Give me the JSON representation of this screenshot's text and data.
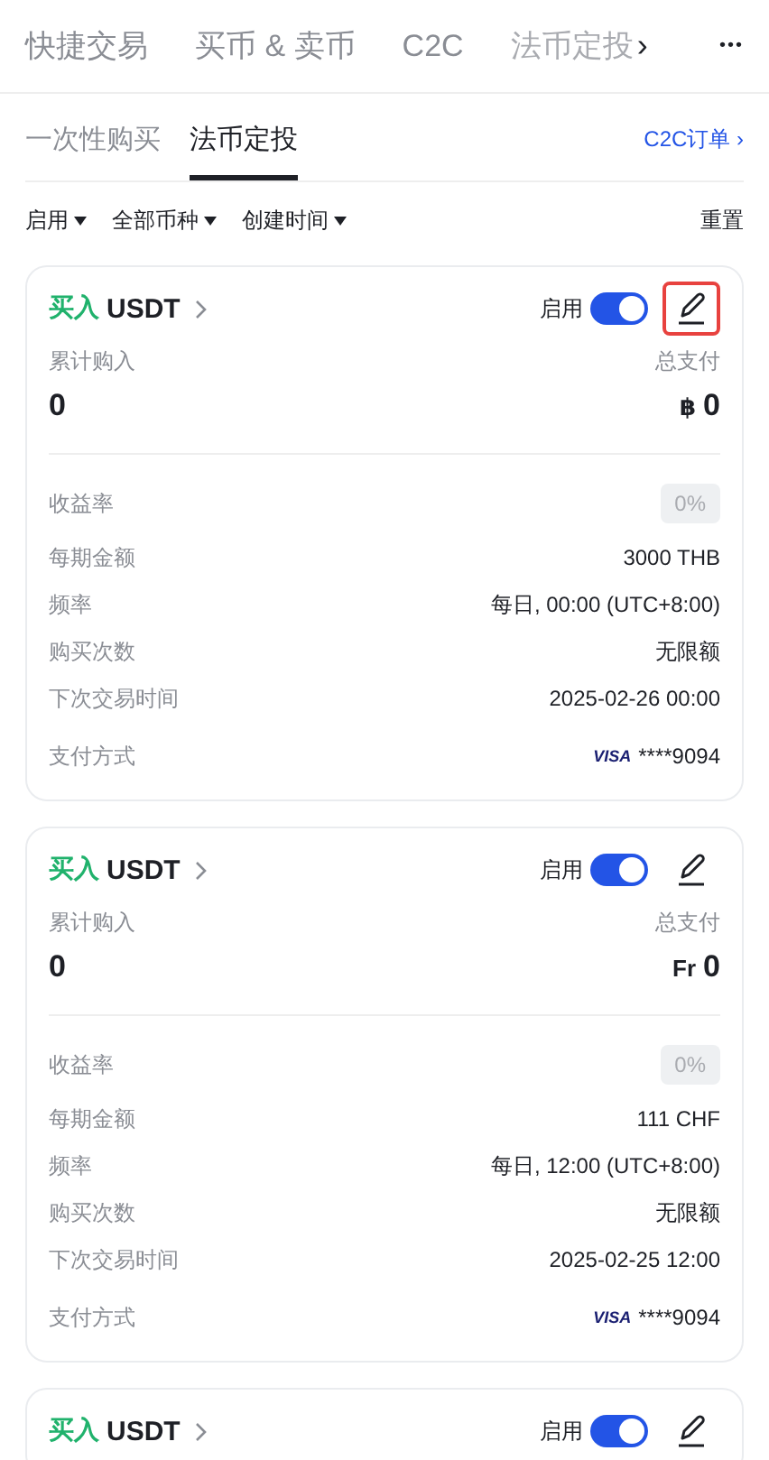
{
  "top_tabs": [
    {
      "label": "快捷交易",
      "selected": false
    },
    {
      "label": "买币 & 卖币",
      "selected": false
    },
    {
      "label": "C2C",
      "selected": false
    },
    {
      "label": "法币定投",
      "selected": false
    }
  ],
  "top_more": "›",
  "top_menu": "•••",
  "sub_tabs": [
    {
      "label": "一次性购买",
      "selected": false
    },
    {
      "label": "法币定投",
      "selected": true
    }
  ],
  "orders_link": "C2C订单 ›",
  "filters": [
    {
      "label": "启用"
    },
    {
      "label": "全部币种"
    },
    {
      "label": "创建时间"
    }
  ],
  "reset": "重置",
  "plans": [
    {
      "side": "买入",
      "asset": "USDT",
      "toggle_label": "启用",
      "on": true,
      "edit_highlighted": true,
      "bought_label": "累计购入",
      "bought": "0",
      "paid_label": "总支付",
      "currency": "฿",
      "paid": "0",
      "rate_label": "收益率",
      "rate": "0%",
      "rows": [
        {
          "label": "每期金额",
          "value": "3000 THB"
        },
        {
          "label": "频率",
          "value": "每日, 00:00 (UTC+8:00)"
        },
        {
          "label": "购买次数",
          "value": "无限额"
        },
        {
          "label": "下次交易时间",
          "value": "2025-02-26 00:00"
        }
      ],
      "pay_label": "支付方式",
      "card_brand": "VISA",
      "card_number": "****9094"
    },
    {
      "side": "买入",
      "asset": "USDT",
      "toggle_label": "启用",
      "on": true,
      "edit_highlighted": false,
      "bought_label": "累计购入",
      "bought": "0",
      "paid_label": "总支付",
      "currency": "Fr",
      "paid": "0",
      "rate_label": "收益率",
      "rate": "0%",
      "rows": [
        {
          "label": "每期金额",
          "value": "111 CHF"
        },
        {
          "label": "频率",
          "value": "每日, 12:00 (UTC+8:00)"
        },
        {
          "label": "购买次数",
          "value": "无限额"
        },
        {
          "label": "下次交易时间",
          "value": "2025-02-25 12:00"
        }
      ],
      "pay_label": "支付方式",
      "card_brand": "VISA",
      "card_number": "****9094"
    },
    {
      "side": "买入",
      "asset": "USDT",
      "toggle_label": "启用",
      "on": true,
      "edit_highlighted": false
    }
  ]
}
